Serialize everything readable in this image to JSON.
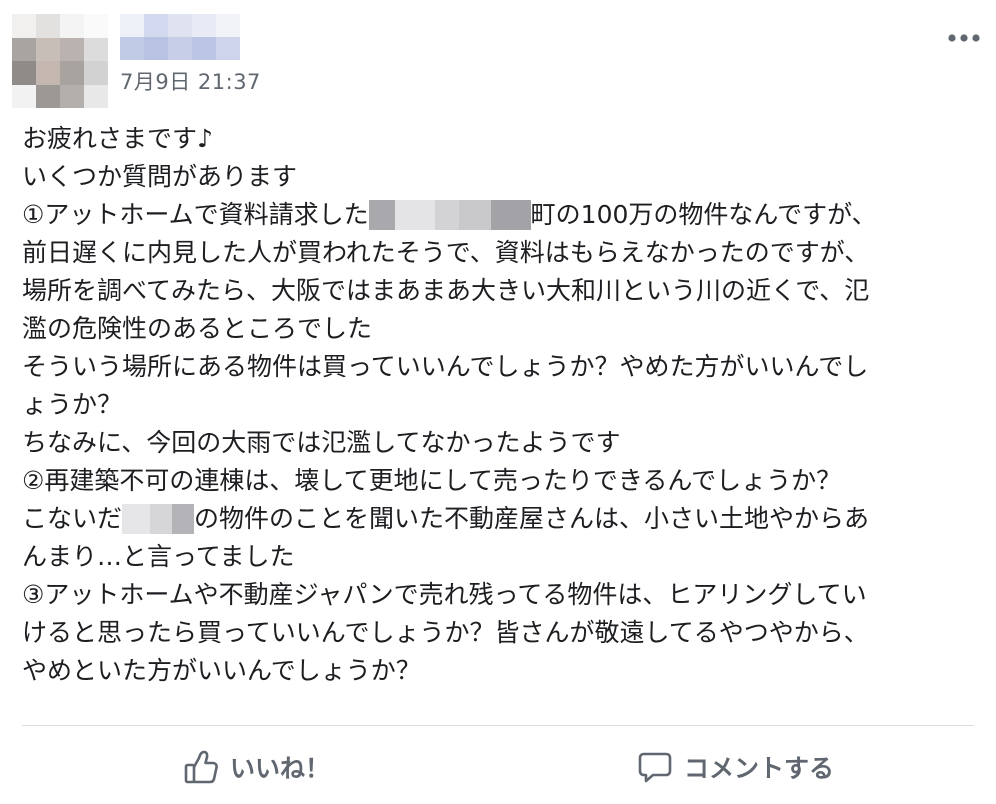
{
  "post": {
    "timestamp": "7月9日 21:37",
    "body": {
      "l1": "お疲れさまです♪",
      "l2": "いくつか質問があります",
      "l3_pre": "①アットホームで資料請求した",
      "l3_post": "町の100万の物件なんですが、",
      "l4": "前日遅くに内見した人が買われたそうで、資料はもらえなかったのですが、",
      "l5": "場所を調べてみたら、大阪ではまあまあ大きい大和川という川の近くで、氾",
      "l6": "濫の危険性のあるところでした",
      "l7": "そういう場所にある物件は買っていいんでしょうか？やめた方がいいんでし",
      "l8": "ょうか？",
      "l9": "ちなみに、今回の大雨では氾濫してなかったようです",
      "l10": "②再建築不可の連棟は、壊して更地にして売ったりできるんでしょうか？",
      "l11_pre": "こないだ",
      "l11_post": "の物件のことを聞いた不動産屋さんは、小さい土地やからあ",
      "l12": "んまり…と言ってました",
      "l13": "③アットホームや不動産ジャパンで売れ残ってる物件は、ヒアリングしてい",
      "l14": "けると思ったら買っていいんでしょうか？皆さんが敬遠してるやつやから、",
      "l15": "やめといた方がいいんでしょうか？"
    }
  },
  "actions": {
    "like_label": "いいね！",
    "comment_label": "コメントする"
  },
  "icons": {
    "more": "more-options-icon",
    "like": "thumbs-up-icon",
    "comment": "comment-bubble-icon"
  },
  "colors": {
    "text": "#1c1e21",
    "secondary": "#606770",
    "divider": "#dadde1",
    "name_blur": "#c5cde6",
    "redaction": "#bdbdc0"
  }
}
